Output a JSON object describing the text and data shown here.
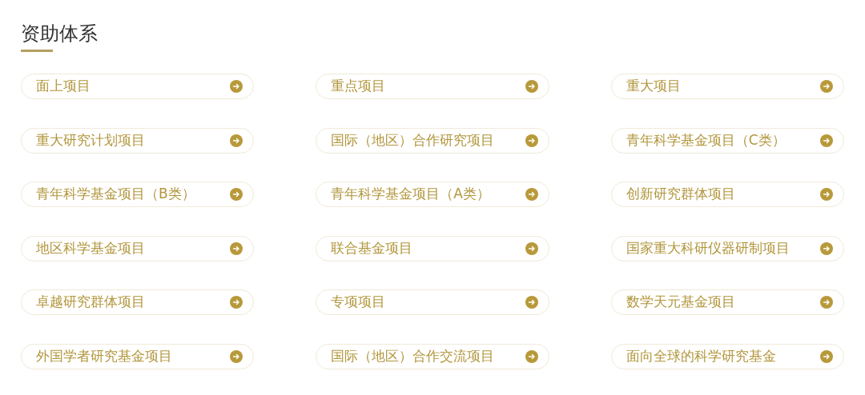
{
  "title": "资助体系",
  "items": [
    {
      "label": "面上项目"
    },
    {
      "label": "重点项目"
    },
    {
      "label": "重大项目"
    },
    {
      "label": "重大研究计划项目"
    },
    {
      "label": "国际（地区）合作研究项目"
    },
    {
      "label": "青年科学基金项目（C类）"
    },
    {
      "label": "青年科学基金项目（B类）"
    },
    {
      "label": "青年科学基金项目（A类）"
    },
    {
      "label": "创新研究群体项目"
    },
    {
      "label": "地区科学基金项目"
    },
    {
      "label": "联合基金项目"
    },
    {
      "label": "国家重大科研仪器研制项目"
    },
    {
      "label": "卓越研究群体项目"
    },
    {
      "label": "专项项目"
    },
    {
      "label": "数学天元基金项目"
    },
    {
      "label": "外国学者研究基金项目"
    },
    {
      "label": "国际（地区）合作交流项目"
    },
    {
      "label": "面向全球的科学研究基金"
    }
  ]
}
